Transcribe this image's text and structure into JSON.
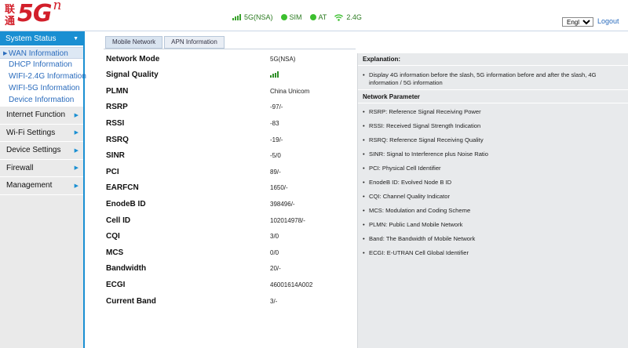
{
  "logo": {
    "cn_top": "联",
    "cn_bottom": "通",
    "big": "5G",
    "sup": "n"
  },
  "status": {
    "network": "5G(NSA)",
    "sim": "SIM",
    "at": "AT",
    "wifi": "2.4G"
  },
  "language": {
    "selected": "English",
    "options": [
      "English"
    ]
  },
  "logout": "Logout",
  "sidebar": {
    "active_section": {
      "label": "System Status"
    },
    "subitems": [
      {
        "label": "WAN Information",
        "active": true
      },
      {
        "label": "DHCP Information"
      },
      {
        "label": "WIFI-2.4G Information"
      },
      {
        "label": "WIFI-5G Information"
      },
      {
        "label": "Device Information"
      }
    ],
    "items": [
      {
        "label": "Internet Function"
      },
      {
        "label": "Wi-Fi Settings"
      },
      {
        "label": "Device Settings"
      },
      {
        "label": "Firewall"
      },
      {
        "label": "Management"
      }
    ]
  },
  "tabs": [
    {
      "label": "Mobile Network",
      "active": true
    },
    {
      "label": "APN Information"
    }
  ],
  "params": [
    {
      "label": "Network Mode",
      "value": "5G(NSA)"
    },
    {
      "label": "Signal Quality",
      "value": ""
    },
    {
      "label": "PLMN",
      "value": "China Unicom"
    },
    {
      "label": "RSRP",
      "value": "-97/-"
    },
    {
      "label": "RSSI",
      "value": "-83"
    },
    {
      "label": "RSRQ",
      "value": "-19/-"
    },
    {
      "label": "SINR",
      "value": "-5/0"
    },
    {
      "label": "PCI",
      "value": "89/-"
    },
    {
      "label": "EARFCN",
      "value": "1650/-"
    },
    {
      "label": "EnodeB ID",
      "value": "398496/-"
    },
    {
      "label": "Cell ID",
      "value": "102014978/-"
    },
    {
      "label": "CQI",
      "value": "3/0"
    },
    {
      "label": "MCS",
      "value": "0/0"
    },
    {
      "label": "Bandwidth",
      "value": "20/-"
    },
    {
      "label": "ECGI",
      "value": "46001614A002"
    },
    {
      "label": "Current Band",
      "value": "3/-"
    }
  ],
  "help": {
    "explanation_title": "Explanation:",
    "explanation_lines": [
      "Display 4G information before the slash, 5G information before and after the slash, 4G information / 5G information"
    ],
    "network_title": "Network Parameter",
    "network_lines": [
      "RSRP: Reference Signal Receiving Power",
      "RSSI: Received Signal Strength Indication",
      "RSRQ: Reference Signal Receiving Quality",
      "SINR: Signal to Interference plus Noise Ratio",
      "PCI: Physical Cell Identifier",
      "EnodeB ID: Evolved Node B ID",
      "CQI: Channel Quality Indicator",
      "MCS: Modulation and Coding Scheme",
      "PLMN: Public Land Mobile Network",
      "Band: The Bandwidth of Mobile Network",
      "ECGI: E-UTRAN Cell Global Identifier"
    ]
  },
  "colors": {
    "accent": "#1a8fd2",
    "brand_red": "#d21f2a",
    "status_green": "#3cbf2f",
    "link_blue": "#2b6cbd"
  },
  "icons": {
    "signal": "signal-bars-icon",
    "dot": "status-dot-icon",
    "wifi": "wifi-icon",
    "menu_arrow": "chevron-right-icon",
    "menu_caret": "chevron-down-icon"
  }
}
